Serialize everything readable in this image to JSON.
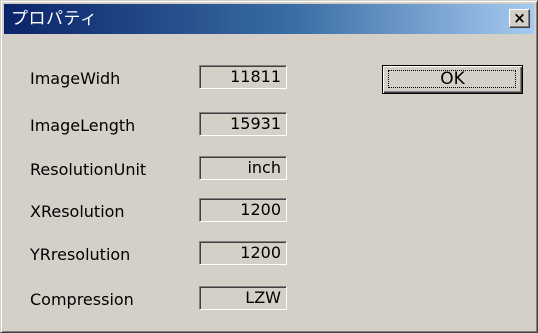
{
  "window": {
    "title": "プロパティ",
    "close_glyph": "×"
  },
  "ok_button": {
    "label": "OK"
  },
  "properties": [
    {
      "label": "ImageWidh",
      "value": "11811"
    },
    {
      "label": "ImageLength",
      "value": "15931"
    },
    {
      "label": "ResolutionUnit",
      "value": "inch"
    },
    {
      "label": "XResolution",
      "value": "1200"
    },
    {
      "label": "YRresolution",
      "value": "1200"
    },
    {
      "label": "Compression",
      "value": "LZW"
    }
  ]
}
